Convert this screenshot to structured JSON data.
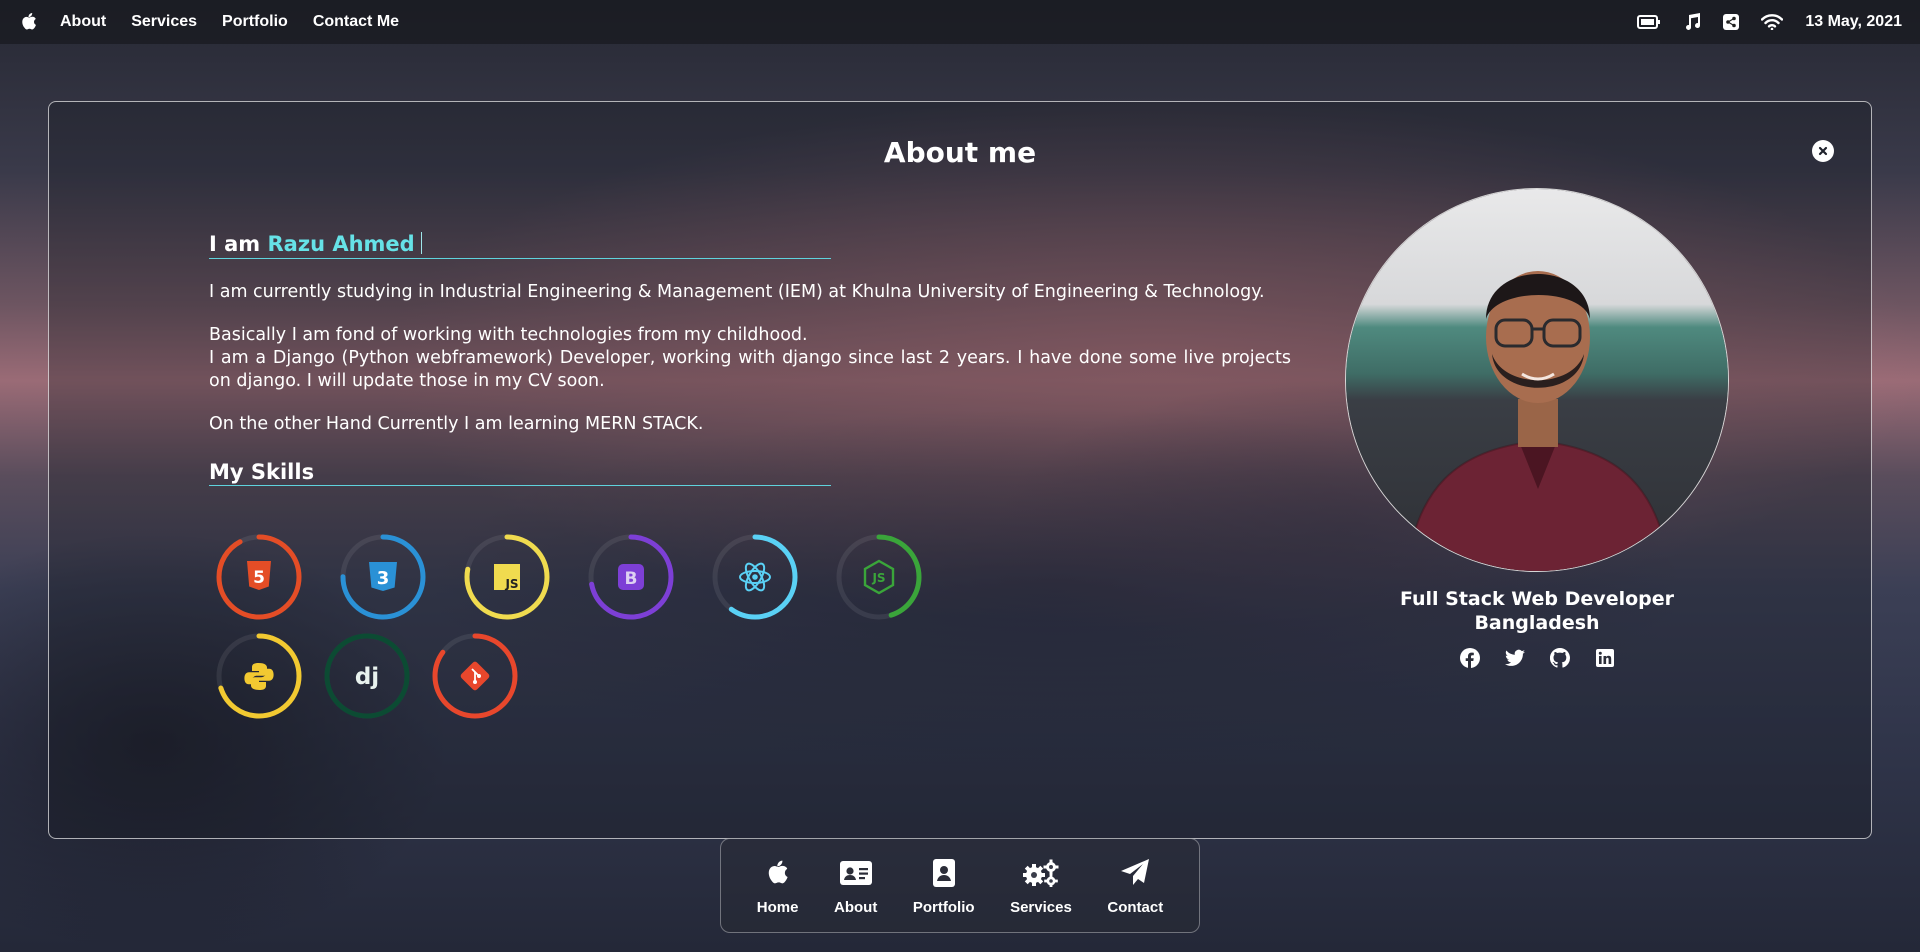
{
  "menubar": {
    "links": [
      "About",
      "Services",
      "Portfolio",
      "Contact Me"
    ],
    "date": "13 May, 2021",
    "icons": [
      "battery-icon",
      "music-icon",
      "share-icon",
      "wifi-icon"
    ]
  },
  "modal": {
    "title": "About me",
    "greeting_prefix": "I am",
    "name": "Razu Ahmed",
    "paragraphs": [
      "I am currently studying in Industrial Engineering & Management (IEM) at Khulna University of Engineering & Technology.",
      "Basically I am fond of working with technologies from my childhood.",
      "I am a Django (Python webframework) Developer, working with django since last 2 years. I have done some live projects on django. I will update those in my CV soon.",
      "On the other Hand Currently I am learning MERN STACK."
    ],
    "skills_title": "My Skills",
    "skills": [
      {
        "name": "html5",
        "label": "5",
        "color": "#e44d26",
        "level": 0.92
      },
      {
        "name": "css3",
        "label": "3",
        "color": "#2a91d6",
        "level": 0.75
      },
      {
        "name": "javascript",
        "label": "JS",
        "color": "#f0db4f",
        "level": 0.78
      },
      {
        "name": "bootstrap",
        "label": "B",
        "color": "#7d3fd6",
        "level": 0.72
      },
      {
        "name": "react",
        "label": "",
        "color": "#5ad1f5",
        "level": 0.6
      },
      {
        "name": "nodejs",
        "label": "JS",
        "color": "#3aa53a",
        "level": 0.45
      },
      {
        "name": "python",
        "label": "",
        "color": "#f2c931",
        "level": 0.7
      },
      {
        "name": "django",
        "label": "dj",
        "color": "#0c4b33",
        "level": 1.0
      },
      {
        "name": "git",
        "label": "",
        "color": "#e8472c",
        "level": 0.85
      }
    ],
    "profile": {
      "role": "Full Stack Web Developer",
      "country": "Bangladesh",
      "socials": [
        "facebook-icon",
        "twitter-icon",
        "github-icon",
        "linkedin-icon"
      ]
    }
  },
  "dock": [
    {
      "label": "Home",
      "icon": "apple-icon"
    },
    {
      "label": "About",
      "icon": "id-card-icon"
    },
    {
      "label": "Portfolio",
      "icon": "portfolio-icon"
    },
    {
      "label": "Services",
      "icon": "gears-icon"
    },
    {
      "label": "Contact",
      "icon": "paper-plane-icon"
    }
  ]
}
